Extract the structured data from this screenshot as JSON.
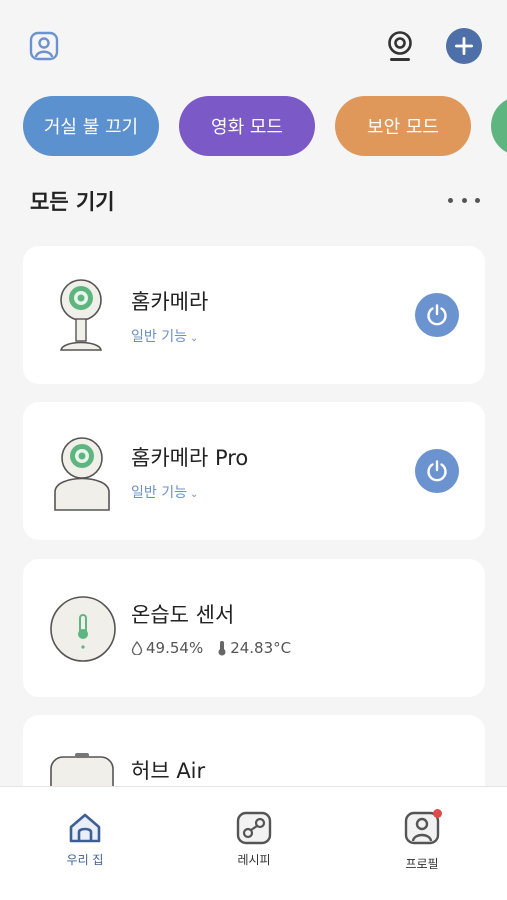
{
  "header": {
    "profile_icon": "profile-icon",
    "camera_icon": "camera-icon",
    "add_icon": "plus-icon"
  },
  "scenes": [
    {
      "label": "거실 불 끄기",
      "color": "#5b91cf"
    },
    {
      "label": "영화 모드",
      "color": "#7b59c6"
    },
    {
      "label": "보안 모드",
      "color": "#e0975a"
    },
    {
      "label": "",
      "color": "#5fb580"
    }
  ],
  "devices_section": {
    "title": "모든 기기",
    "more_icon": "more-horizontal-icon"
  },
  "devices": [
    {
      "name": "홈카메라",
      "sub": "일반 기능",
      "icon": "home-camera-icon",
      "power_icon": "power-icon"
    },
    {
      "name": "홈카메라 Pro",
      "sub": "일반 기능",
      "icon": "home-camera-pro-icon",
      "power_icon": "power-icon"
    },
    {
      "name": "온습도 센서",
      "humidity": "49.54%",
      "temperature": "24.83°C",
      "icon": "thermometer-icon"
    },
    {
      "name": "허브 Air",
      "icon": "hub-icon"
    }
  ],
  "bottom_nav": [
    {
      "label": "우리 집",
      "icon": "home-icon",
      "active": true
    },
    {
      "label": "레시피",
      "icon": "recipe-icon",
      "active": false
    },
    {
      "label": "프로필",
      "icon": "profile-icon",
      "active": false
    }
  ],
  "colors": {
    "accent": "#4f6fa8",
    "power": "#6b93cf",
    "background": "#f5f5f5"
  }
}
